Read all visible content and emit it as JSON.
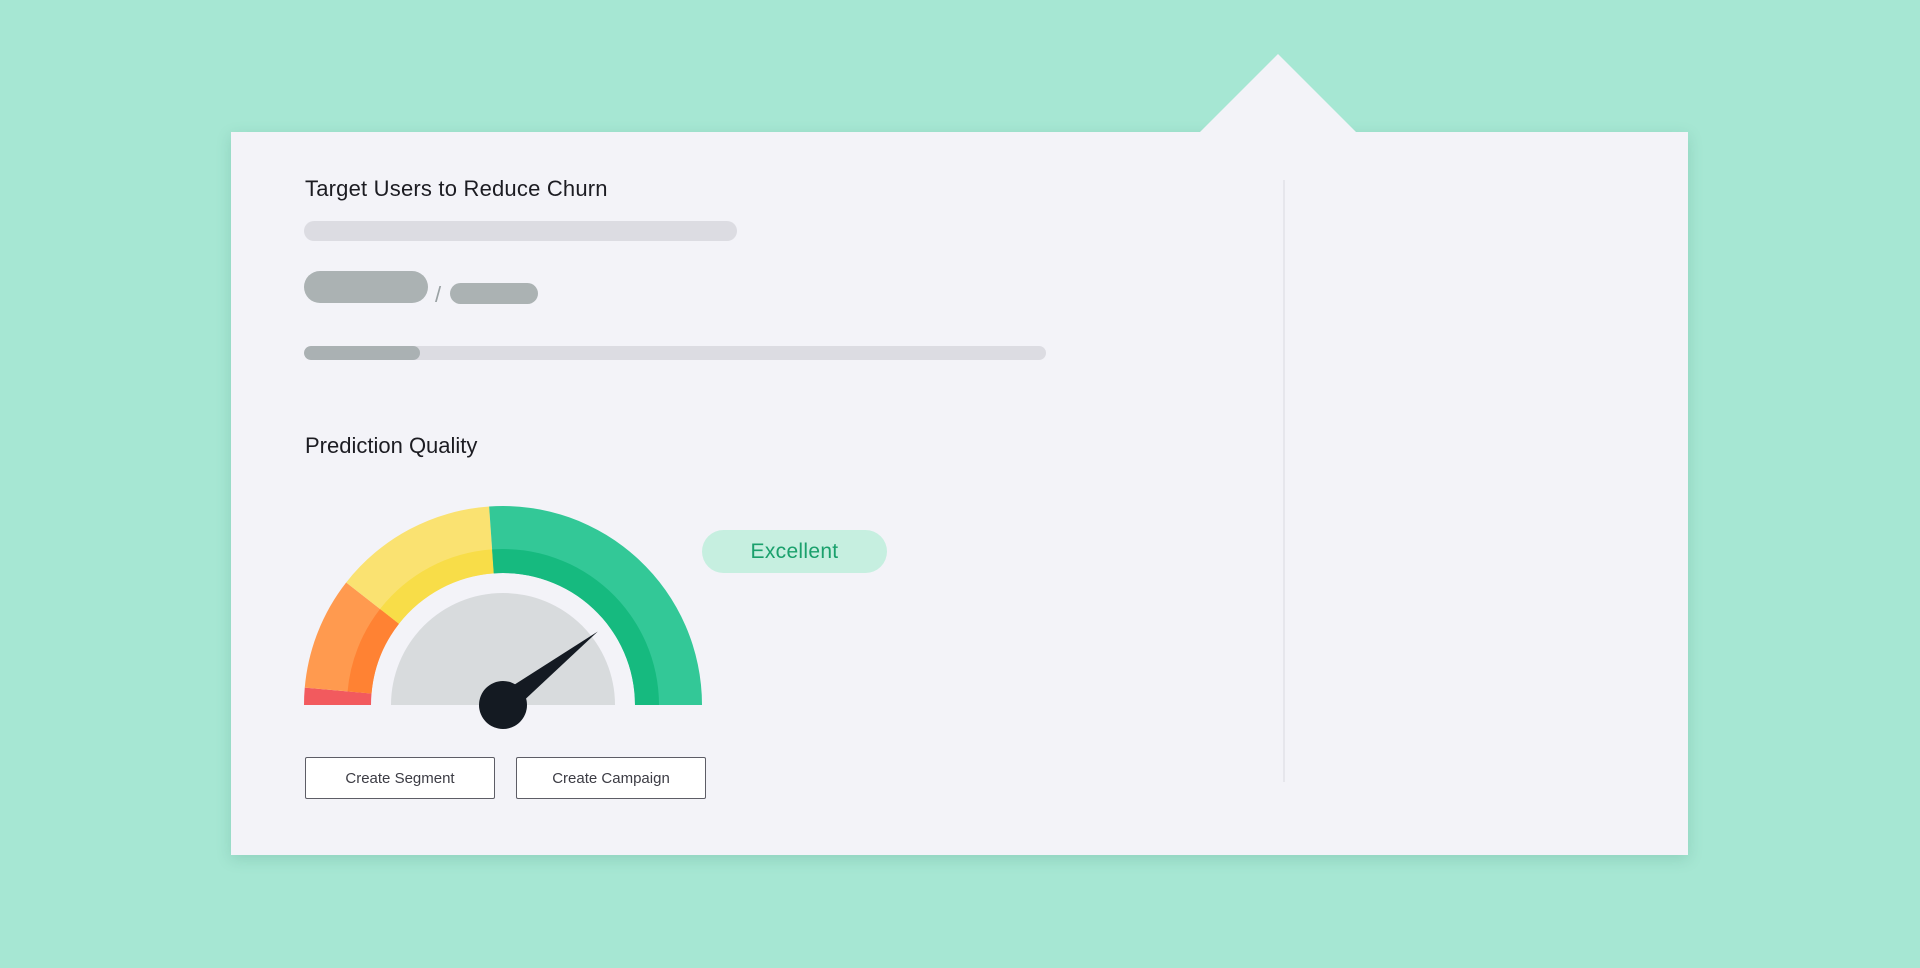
{
  "card": {
    "title": "Target Users to Reduce Churn",
    "separator": "/",
    "progress_fraction": 0.156
  },
  "prediction": {
    "section_title": "Prediction Quality",
    "quality_label": "Excellent",
    "needle_level": 0.79,
    "gauge_colors": {
      "red": "#f25a5e",
      "orange_outer": "#ff9a4f",
      "orange_inner": "#ff8233",
      "yellow_outer": "#fae271",
      "yellow_inner": "#f8dd48",
      "green_outer": "#33c897",
      "green_inner": "#16ba7f",
      "hub": "#d8dbdd",
      "needle": "#141a22"
    }
  },
  "actions": {
    "create_segment_label": "Create Segment",
    "create_campaign_label": "Create Campaign"
  }
}
